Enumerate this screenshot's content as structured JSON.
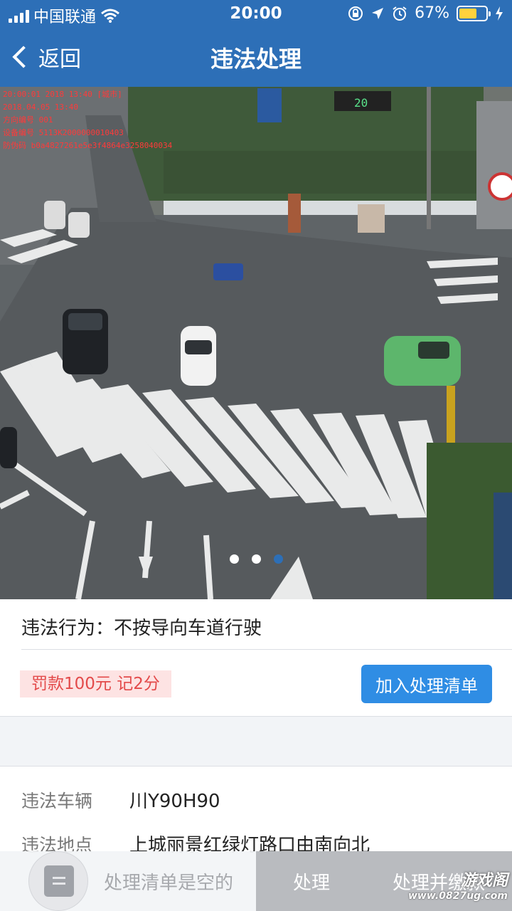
{
  "status_bar": {
    "carrier": "中国联通",
    "time": "20:00",
    "battery": "67%",
    "battery_level": 0.67
  },
  "nav": {
    "back_label": "返回",
    "title": "违法处理"
  },
  "photo": {
    "overlay_lines": [
      "20:00:01 2018 13:40 [城市]",
      "2018.04.05 13:40",
      "方向编号 001",
      "设备编号 5113K2000000010403",
      "防伪码 b0a4827261e5e3f4864e3258040034"
    ],
    "signal_countdown": "20",
    "carousel": {
      "count": 3,
      "active_index": 2
    }
  },
  "violation": {
    "behavior": "违法行为：不按导向车道行驶",
    "fine": "罚款100元  记2分",
    "add_button": "加入处理清单"
  },
  "details": {
    "vehicle_label": "违法车辆",
    "vehicle_value": "川Y90H90",
    "location_label": "违法地点",
    "location_value": "上城丽景红绿灯路口由南向北"
  },
  "bottom_bar": {
    "cart_empty": "处理清单是空的",
    "process_button": "处理",
    "pay_button": "处理并缴款"
  },
  "watermark": {
    "line1": "游戏阁",
    "line2": "www.0827ug.com"
  },
  "colors": {
    "brand_blue": "#2d6fb7",
    "button_blue": "#2f8de4",
    "fine_red": "#e34a4a"
  }
}
